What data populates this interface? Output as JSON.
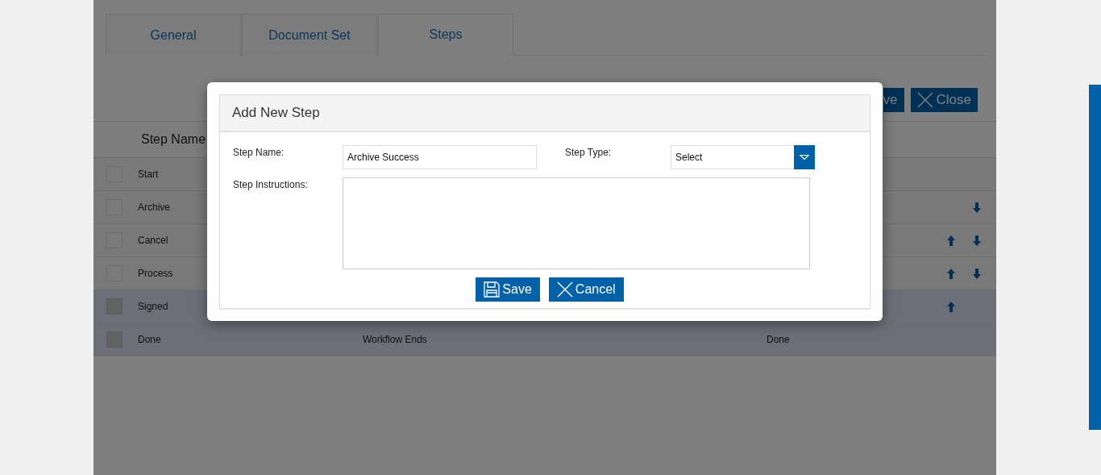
{
  "tabs": [
    {
      "label": "General",
      "selected": false
    },
    {
      "label": "Document Set",
      "selected": false
    },
    {
      "label": "Steps",
      "selected": true
    }
  ],
  "toolbar": {
    "buttons": [
      {
        "kind": "text",
        "label": "ve"
      },
      {
        "kind": "close",
        "label": "Close"
      }
    ]
  },
  "table": {
    "columns": [
      "Step Name"
    ],
    "rows": [
      {
        "name": "Start",
        "selected": false,
        "can_move_up": false,
        "can_move_down": false
      },
      {
        "name": "Archive",
        "selected": false,
        "can_move_up": false,
        "can_move_down": true
      },
      {
        "name": "Cancel",
        "selected": false,
        "can_move_up": true,
        "can_move_down": true
      },
      {
        "name": "Process",
        "selected": false,
        "can_move_up": true,
        "can_move_down": true
      },
      {
        "name": "Signed",
        "selected": true,
        "can_move_up": true,
        "can_move_down": false
      },
      {
        "name": "Done",
        "column_2": "Workflow Ends",
        "column_3": "Done",
        "selected": true,
        "can_move_up": false,
        "can_move_down": false
      }
    ]
  },
  "dialog": {
    "title": "Add New Step",
    "step_name": {
      "label": "Step Name:",
      "value": "Archive Success"
    },
    "step_type": {
      "label": "Step Type:",
      "value": "Select"
    },
    "step_instructions": {
      "label": "Step Instructions:"
    },
    "buttons": [
      {
        "kind": "save",
        "label": "Save"
      },
      {
        "kind": "cancel",
        "label": "Cancel"
      }
    ]
  }
}
